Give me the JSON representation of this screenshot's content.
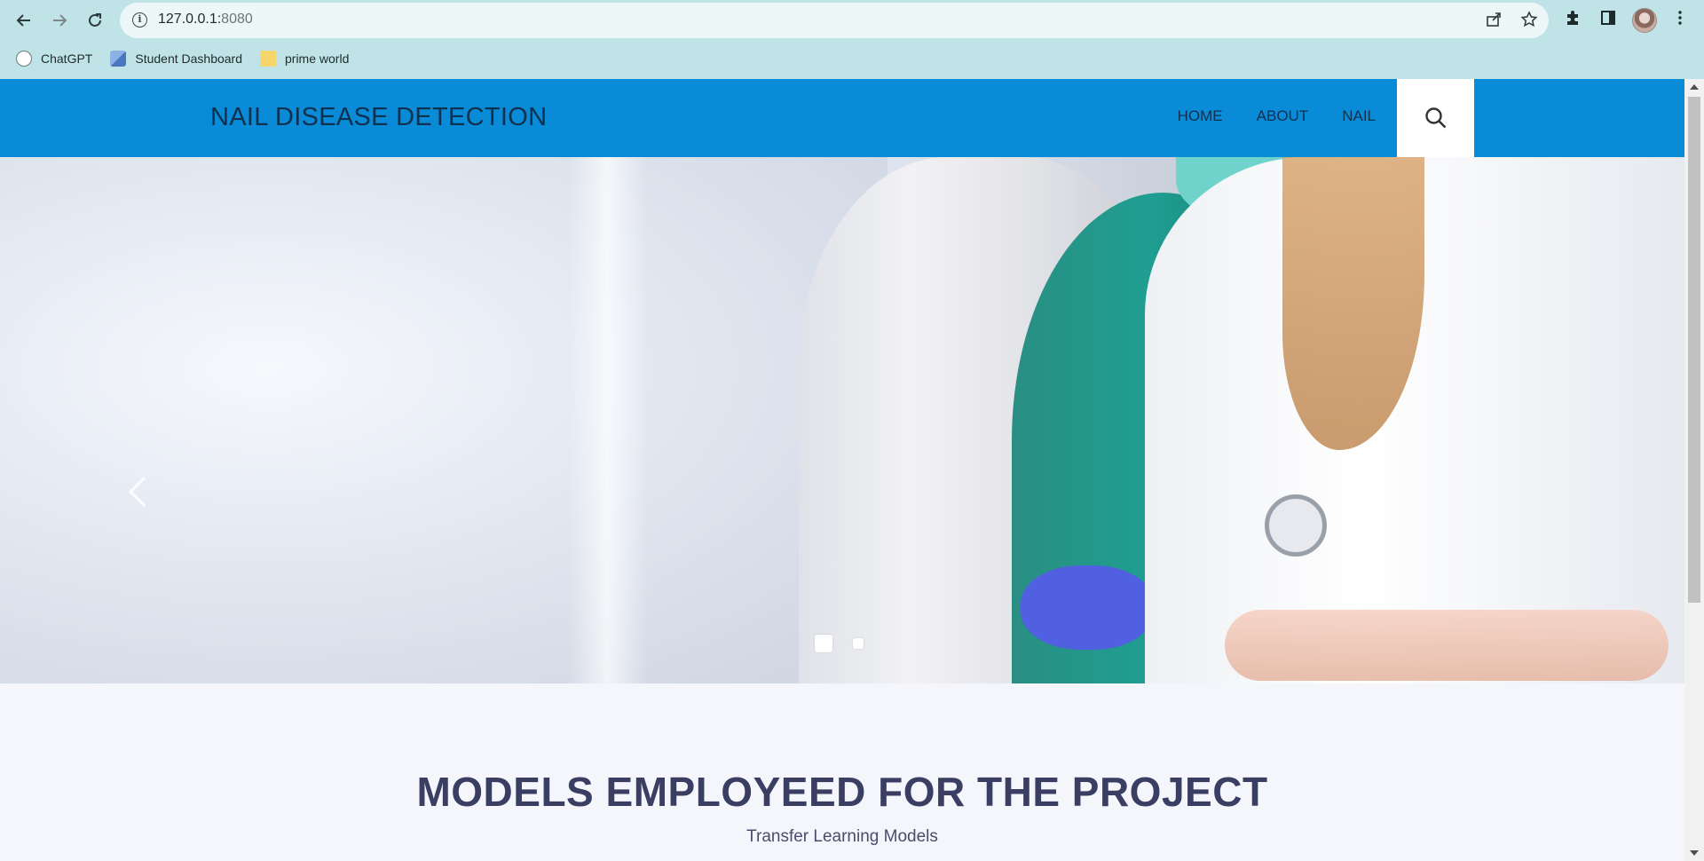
{
  "browser": {
    "url_host": "127.0.0.1:",
    "url_port": "8080",
    "bookmarks": [
      {
        "label": "ChatGPT",
        "icon": "chatgpt-icon"
      },
      {
        "label": "Student Dashboard",
        "icon": "dashboard-icon"
      },
      {
        "label": "prime world",
        "icon": "folder-icon"
      }
    ]
  },
  "site": {
    "brand": "NAIL DISEASE DETECTION",
    "menu": [
      "HOME",
      "ABOUT",
      "NAIL"
    ],
    "accent_color": "#0a8bd7"
  },
  "carousel": {
    "slide_count": 2,
    "active_index": 0
  },
  "section": {
    "title": "MODELS EMPLOYEED FOR THE PROJECT",
    "subtitle": "Transfer Learning Models"
  }
}
